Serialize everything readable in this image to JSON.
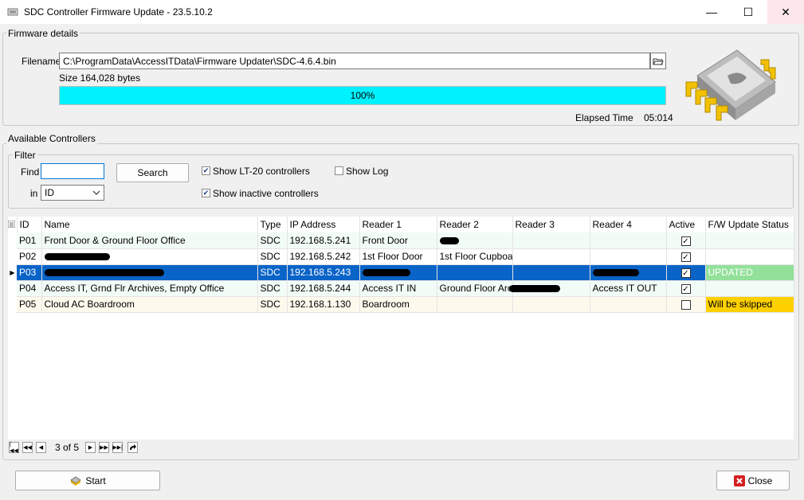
{
  "window": {
    "title": "SDC Controller Firmware Update - 23.5.10.2",
    "minimize_glyph": "—",
    "maximize_glyph": "☐",
    "close_glyph": "✕"
  },
  "firmware": {
    "group_label": "Firmware details",
    "filename_label": "Filename",
    "filename_value": "C:\\ProgramData\\AccessITData\\Firmware Updater\\SDC-4.6.4.bin",
    "size_text": "Size 164,028 bytes",
    "progress_percent": 100,
    "progress_text": "100%",
    "progress_color": "#00f2ff",
    "elapsed_label": "Elapsed Time",
    "elapsed_value": "05:014",
    "browse_icon": "folder-open-icon",
    "art_icon": "chip-icon"
  },
  "controllers": {
    "group_label": "Available Controllers",
    "filter": {
      "group_label": "Filter",
      "find_label": "Find",
      "find_value": "",
      "in_label": "in",
      "in_value": "ID",
      "search_label": "Search",
      "show_lt20_label": "Show LT-20 controllers",
      "show_lt20_checked": true,
      "show_log_label": "Show Log",
      "show_log_checked": false,
      "show_inactive_label": "Show inactive controllers",
      "show_inactive_checked": true
    },
    "columns": [
      "ID",
      "Name",
      "Type",
      "IP Address",
      "Reader 1",
      "Reader 2",
      "Reader 3",
      "Reader 4",
      "Active",
      "F/W Update Status"
    ],
    "rows": [
      {
        "id": "P01",
        "name": "Front Door & Ground Floor Office",
        "type": "SDC",
        "ip": "192.168.5.241",
        "reader1": "Front Door",
        "reader2": "",
        "reader3": "",
        "reader4": "",
        "active": true,
        "status": ""
      },
      {
        "id": "P02",
        "name": "",
        "type": "SDC",
        "ip": "192.168.5.242",
        "reader1": "1st Floor Door",
        "reader2": "1st Floor Cupboa",
        "reader3": "",
        "reader4": "",
        "active": true,
        "status": ""
      },
      {
        "id": "P03",
        "name": "",
        "type": "SDC",
        "ip": "192.168.5.243",
        "reader1": "",
        "reader2": "",
        "reader3": "",
        "reader4": "",
        "active": true,
        "status": "UPDATED"
      },
      {
        "id": "P04",
        "name": "Access IT, Grnd Flr Archives, Empty Office",
        "type": "SDC",
        "ip": "192.168.5.244",
        "reader1": "Access IT IN",
        "reader2": "Ground Floor Arc",
        "reader3": "",
        "reader4": "Access IT OUT",
        "active": true,
        "status": ""
      },
      {
        "id": "P05",
        "name": "Cloud AC Boardroom",
        "type": "SDC",
        "ip": "192.168.1.130",
        "reader1": "Boardroom",
        "reader2": "",
        "reader3": "",
        "reader4": "",
        "active": false,
        "status": "Will be skipped"
      }
    ],
    "current_row_marker": "▶",
    "status_colors": {
      "updated": "#93e09a",
      "skipped": "#ffd000",
      "selected": "#0a64c8"
    },
    "pager": {
      "text": "3 of 5"
    }
  },
  "footer": {
    "start_label": "Start",
    "close_label": "Close"
  }
}
